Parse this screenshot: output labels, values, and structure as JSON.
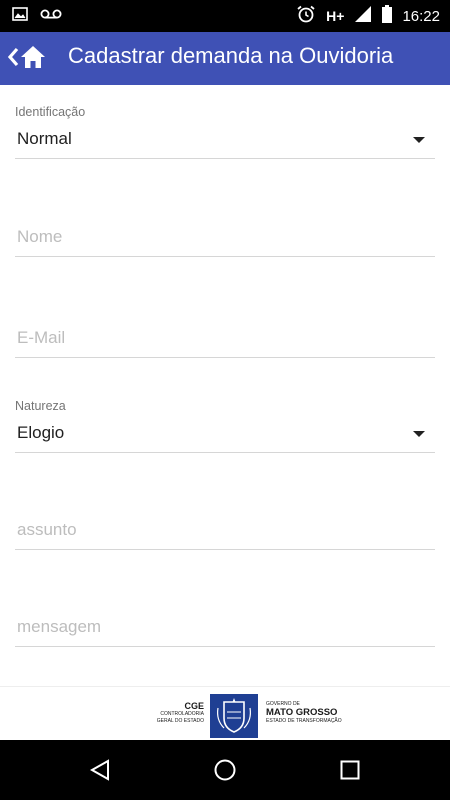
{
  "status_bar": {
    "network": "H+",
    "time": "16:22",
    "icons": [
      "image-icon",
      "voicemail-icon",
      "alarm-icon",
      "signal-icon",
      "battery-icon"
    ]
  },
  "app_bar": {
    "title": "Cadastrar demanda na Ouvidoria",
    "background": "#3f51b5"
  },
  "form": {
    "identificacao": {
      "label": "Identificação",
      "value": "Normal"
    },
    "nome": {
      "placeholder": "Nome",
      "value": ""
    },
    "email": {
      "placeholder": "E-Mail",
      "value": ""
    },
    "natureza": {
      "label": "Natureza",
      "value": "Elogio"
    },
    "assunto": {
      "placeholder": "assunto",
      "value": ""
    },
    "mensagem": {
      "placeholder": "mensagem",
      "value": ""
    }
  },
  "footer": {
    "cge": {
      "title": "CGE",
      "line1": "CONTROLADORIA",
      "line2": "GERAL DO ESTADO"
    },
    "governo": {
      "line1": "GOVERNO DE",
      "title": "MATO GROSSO",
      "line2": "ESTADO DE TRANSFORMAÇÃO"
    }
  },
  "nav_bar": {
    "icons": [
      "back-icon",
      "home-icon",
      "recents-icon"
    ]
  }
}
